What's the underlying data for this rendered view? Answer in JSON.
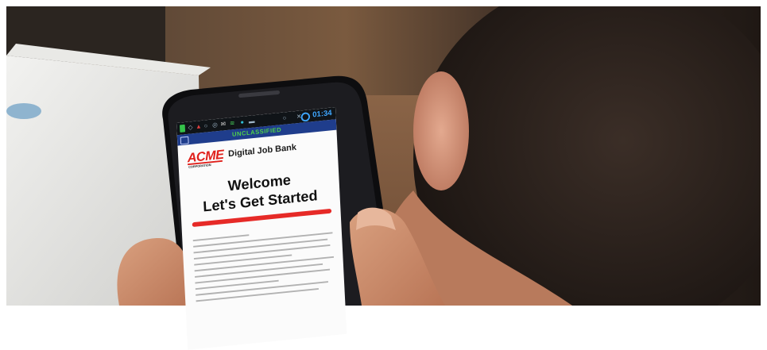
{
  "phone": {
    "status": {
      "time": "01:34"
    },
    "banner": {
      "text": "UNCLASSIFIED"
    },
    "app": {
      "logo_text": "ACME",
      "logo_subtext": "CORPORATION",
      "title": "Digital Job Bank",
      "heading_line1": "Welcome",
      "heading_line2": "Let's Get Started",
      "accent_color": "#e62a27"
    }
  }
}
